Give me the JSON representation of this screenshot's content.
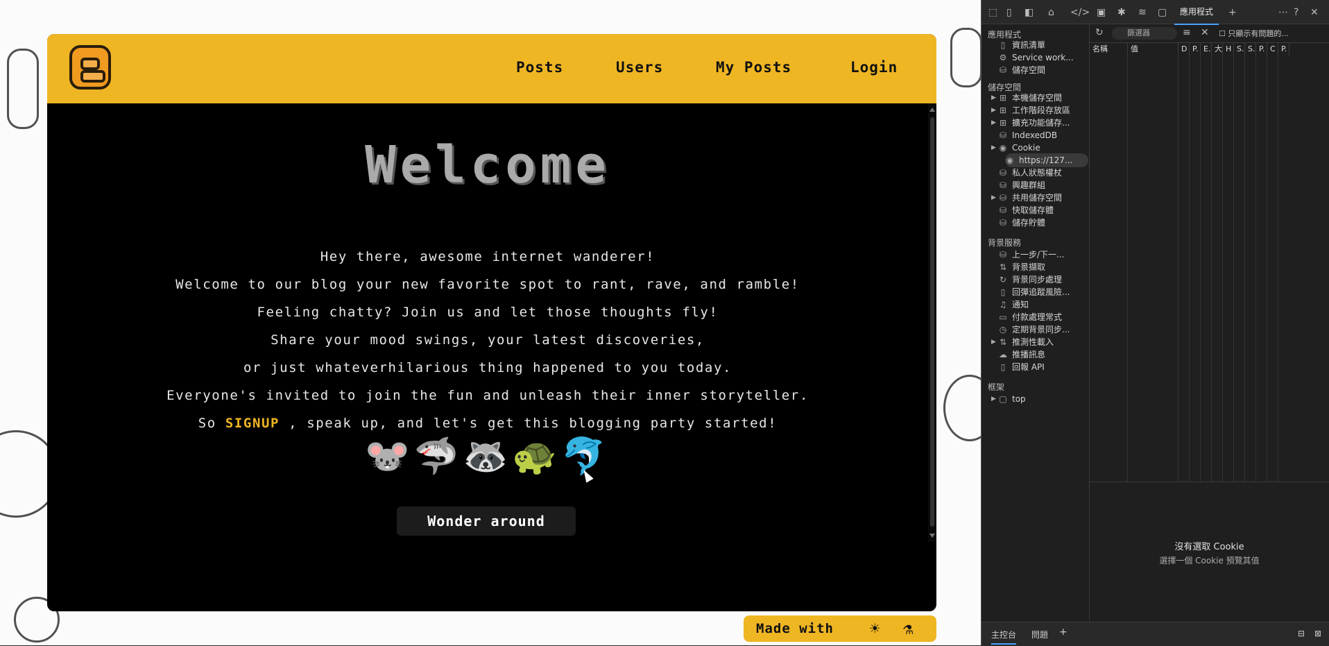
{
  "site": {
    "nav": {
      "posts": "Posts",
      "users": "Users",
      "my_posts": "My Posts",
      "login": "Login"
    },
    "hero": {
      "title": "Welcome",
      "lines": [
        "Hey there, awesome internet wanderer!",
        "Welcome to our blog your new favorite spot to rant, rave, and ramble!",
        "Feeling chatty? Join us and let those thoughts fly!",
        "Share your mood swings, your latest discoveries,",
        "or just whateverhilarious thing happened to you today.",
        "Everyone's invited to join the fun and unleash their inner storyteller."
      ],
      "last_line_pre": "So",
      "signup": "SIGNUP",
      "last_line_post": ", speak up, and let's get this blogging party started!",
      "emoji": "🐭🦈🦝🐢🐬",
      "button": "Wonder around"
    },
    "footer_badge": "Made with",
    "footer_icons": [
      "sun-icon",
      "flask-icon"
    ],
    "colors": {
      "accent": "#efb624",
      "background": "#000000"
    }
  },
  "devtools": {
    "active_tab": "應用程式",
    "sections": {
      "app": "應用程式",
      "storage": "儲存空間",
      "background": "背景服務",
      "frames": "框架"
    },
    "app_items": [
      "資訊清單",
      "Service work...",
      "儲存空間"
    ],
    "storage_items": [
      "本機儲存空間",
      "工作階段存放區",
      "擴充功能儲存...",
      "IndexedDB",
      "Cookie",
      "https://127...",
      "私人狀態權杖",
      "興趣群組",
      "共用儲存空間",
      "快取儲存體",
      "儲存貯體"
    ],
    "background_items": [
      "上一步/下一...",
      "背景擷取",
      "背景同步處理",
      "回彈追蹤風險...",
      "通知",
      "付款處理常式",
      "定期背景同步...",
      "推測性載入",
      "推播訊息",
      "回報 API"
    ],
    "frame_items": [
      "top"
    ],
    "filter_placeholder": "篩選器",
    "only_issues": "只顯示有問題的...",
    "columns": [
      "名稱",
      "值",
      "D",
      "P.",
      "E.",
      "大",
      "H",
      "S.",
      "S.",
      "P.",
      "C",
      "P."
    ],
    "empty_title": "沒有選取 Cookie",
    "empty_hint": "選擇一個 Cookie 預覽其值",
    "drawer_tabs": [
      "主控台",
      "問題"
    ]
  }
}
